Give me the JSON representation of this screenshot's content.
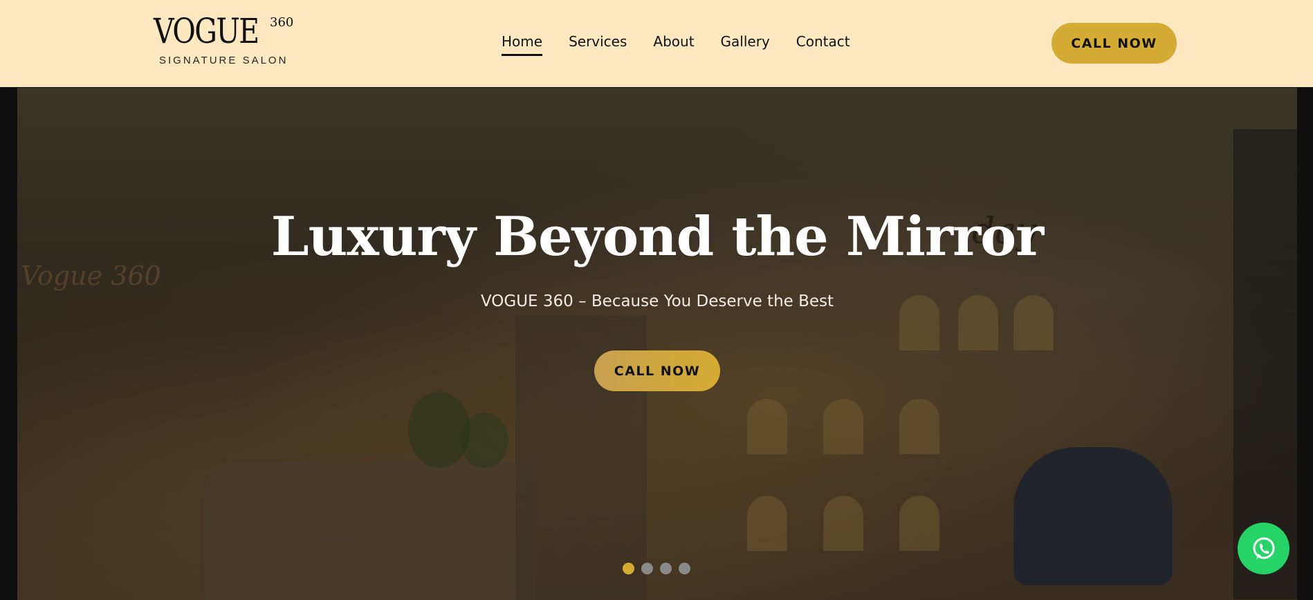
{
  "header": {
    "logo": {
      "word": "VOGUE",
      "superscript": "360",
      "tagline": "SIGNATURE SALON"
    },
    "nav": [
      {
        "label": "Home",
        "active": true
      },
      {
        "label": "Services",
        "active": false
      },
      {
        "label": "About",
        "active": false
      },
      {
        "label": "Gallery",
        "active": false
      },
      {
        "label": "Contact",
        "active": false
      }
    ],
    "cta_label": "CALL NOW"
  },
  "hero": {
    "title": "Luxury Beyond the Mirror",
    "subtitle": "VOGUE 360 – Because You Deserve the Best",
    "cta_label": "CALL NOW",
    "background_signage": "day",
    "wall_logo": "Vogue 360"
  },
  "carousel": {
    "slides": 4,
    "active_index": 0
  },
  "colors": {
    "header_bg": "#fde8c1",
    "accent_gold": "#d6ab33",
    "whatsapp_green": "#25d366"
  },
  "floating": {
    "icon": "whatsapp-icon"
  }
}
